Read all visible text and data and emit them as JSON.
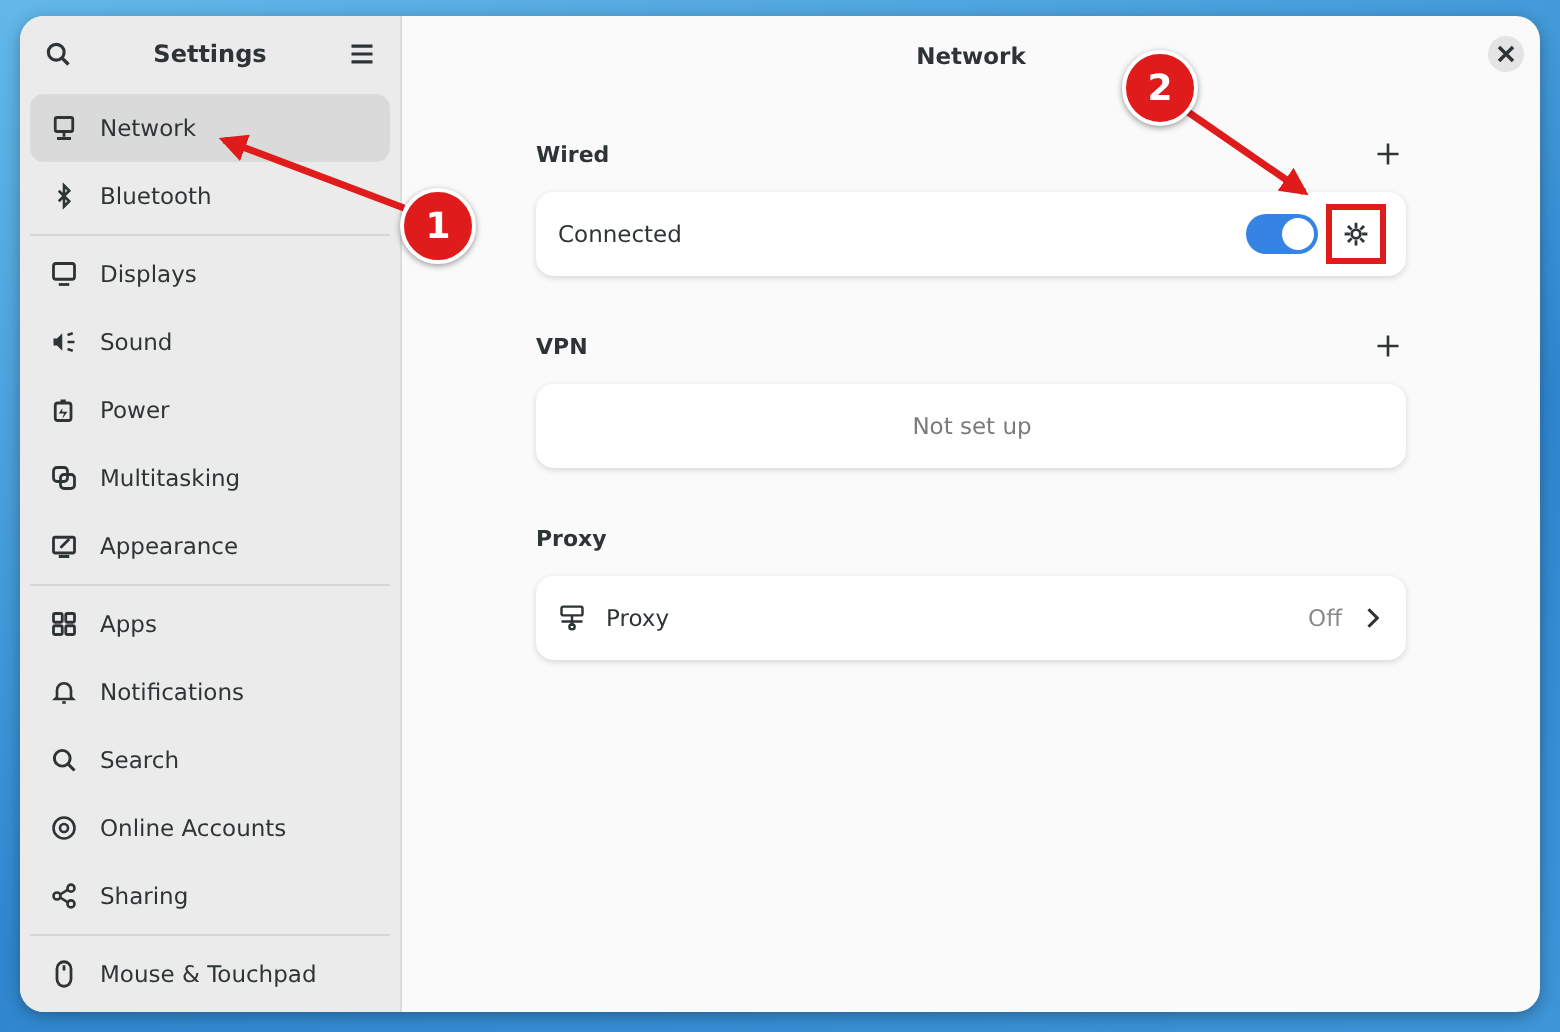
{
  "sidebar": {
    "title": "Settings",
    "groups": [
      [
        {
          "label": "Network",
          "selected": true
        },
        {
          "label": "Bluetooth",
          "selected": false
        }
      ],
      [
        {
          "label": "Displays",
          "selected": false
        },
        {
          "label": "Sound",
          "selected": false
        },
        {
          "label": "Power",
          "selected": false
        },
        {
          "label": "Multitasking",
          "selected": false
        },
        {
          "label": "Appearance",
          "selected": false
        }
      ],
      [
        {
          "label": "Apps",
          "selected": false
        },
        {
          "label": "Notifications",
          "selected": false
        },
        {
          "label": "Search",
          "selected": false
        },
        {
          "label": "Online Accounts",
          "selected": false
        },
        {
          "label": "Sharing",
          "selected": false
        }
      ],
      [
        {
          "label": "Mouse & Touchpad",
          "selected": false
        }
      ]
    ]
  },
  "content": {
    "title": "Network",
    "wired": {
      "heading": "Wired",
      "status": "Connected",
      "on": true
    },
    "vpn": {
      "heading": "VPN",
      "empty": "Not set up"
    },
    "proxy": {
      "heading": "Proxy",
      "label": "Proxy",
      "value": "Off"
    }
  },
  "annotations": [
    {
      "number": "1"
    },
    {
      "number": "2"
    }
  ]
}
